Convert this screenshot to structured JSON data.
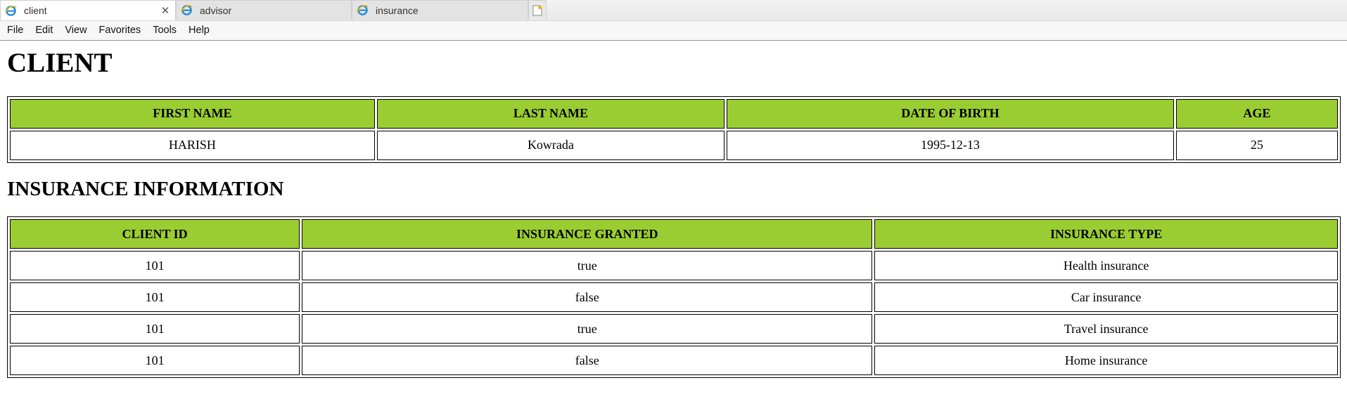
{
  "browser": {
    "tabs": [
      {
        "label": "client",
        "active": true,
        "close": "✕"
      },
      {
        "label": "advisor",
        "active": false
      },
      {
        "label": "insurance",
        "active": false
      }
    ],
    "menu": [
      "File",
      "Edit",
      "View",
      "Favorites",
      "Tools",
      "Help"
    ],
    "icons": {
      "tab": "ie-icon",
      "new_tab": "new-tab-icon",
      "close": "close-icon"
    }
  },
  "page": {
    "title": "CLIENT",
    "client_table": {
      "headers": [
        "FIRST NAME",
        "LAST NAME",
        "DATE OF BIRTH",
        "AGE"
      ],
      "rows": [
        [
          "HARISH",
          "Kowrada",
          "1995-12-13",
          "25"
        ]
      ]
    },
    "insurance_title": "INSURANCE INFORMATION",
    "insurance_table": {
      "headers": [
        "CLIENT ID",
        "INSURANCE GRANTED",
        "INSURANCE TYPE"
      ],
      "rows": [
        [
          "101",
          "true",
          "Health insurance"
        ],
        [
          "101",
          "false",
          "Car insurance"
        ],
        [
          "101",
          "true",
          "Travel insurance"
        ],
        [
          "101",
          "false",
          "Home insurance"
        ]
      ]
    }
  },
  "colors": {
    "header_bg": "#9acd32",
    "border": "#000000"
  }
}
